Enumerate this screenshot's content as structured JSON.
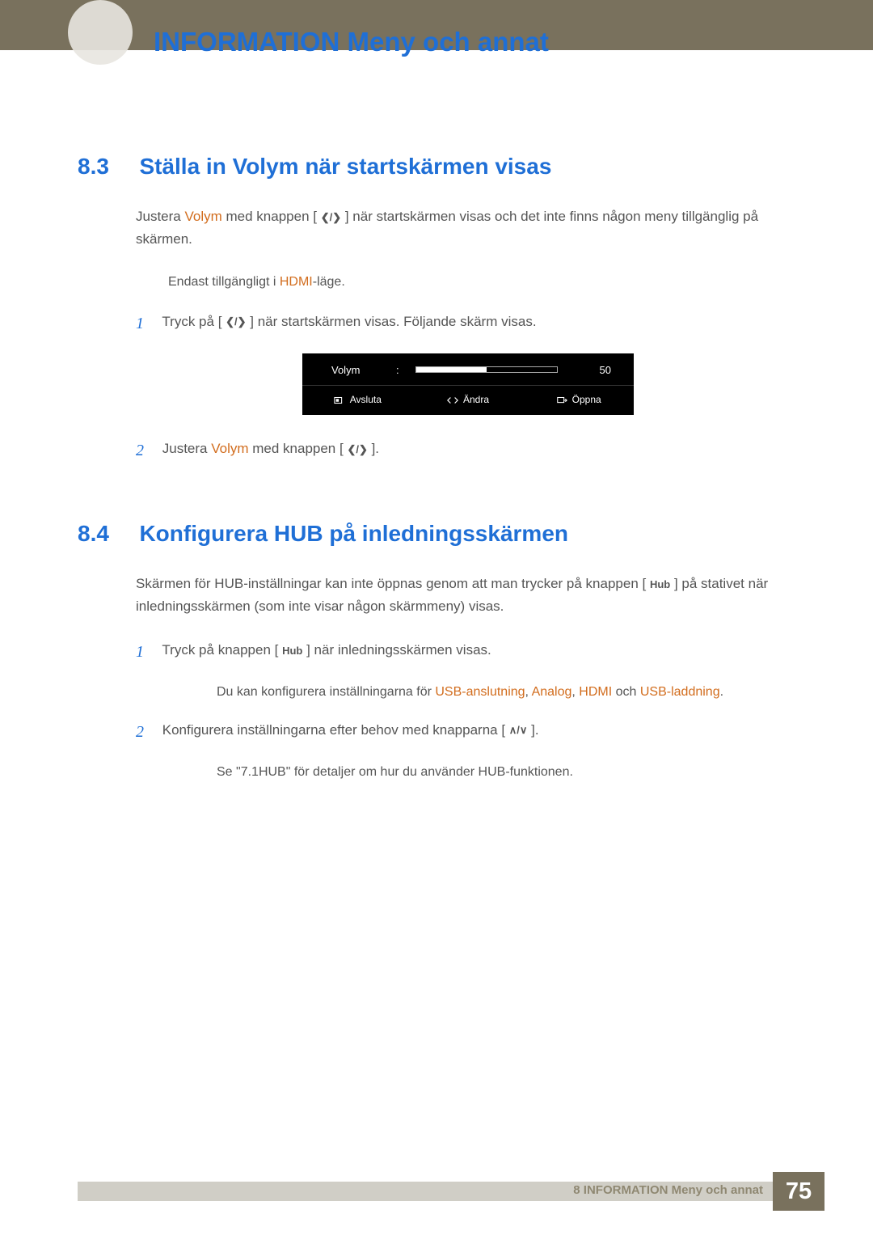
{
  "page_title": "INFORMATION Meny och annat",
  "section_83": {
    "num": "8.3",
    "title": "Ställa in Volym när startskärmen visas",
    "intro_pre": "Justera ",
    "intro_orange": "Volym",
    "intro_post": " med knappen [ ",
    "intro_tail": " ] när startskärmen visas och det inte finns någon meny tillgänglig på skärmen.",
    "note_pre": "Endast tillgängligt i ",
    "note_orange": "HDMI",
    "note_post": "-läge.",
    "step1_num": "1",
    "step1_pre": "Tryck på [ ",
    "step1_post": " ] när startskärmen visas. Följande skärm visas.",
    "step2_num": "2",
    "step2_pre": "Justera ",
    "step2_orange": "Volym",
    "step2_mid": " med knappen [ ",
    "step2_post": " ]."
  },
  "osd": {
    "label": "Volym",
    "value": "50",
    "btn_exit": "Avsluta",
    "btn_change": "Ändra",
    "btn_open": "Öppna"
  },
  "section_84": {
    "num": "8.4",
    "title": "Konfigurera HUB på inledningsskärmen",
    "intro_pre": "Skärmen för HUB-inställningar kan inte öppnas genom att man trycker på knappen [ ",
    "intro_post": " ] på stativet när inledningsskärmen (som inte  visar någon skärmmeny) visas.",
    "step1_num": "1",
    "step1_pre": "Tryck på knappen [ ",
    "step1_post": " ] när inledningsskärmen visas.",
    "subnote_pre": "Du kan konfigurera inställningarna för ",
    "subnote_o1": "USB-anslutning",
    "subnote_sep1": ", ",
    "subnote_o2": "Analog",
    "subnote_sep2": ", ",
    "subnote_o3": "HDMI",
    "subnote_sep3": " och ",
    "subnote_o4": "USB-laddning",
    "subnote_end": ".",
    "step2_num": "2",
    "step2_pre": "Konfigurera inställningarna efter behov med knapparna [ ",
    "step2_post": " ].",
    "ref": "Se \"7.1HUB\" för detaljer om hur du använder HUB-funktionen."
  },
  "footer": {
    "chapter": "8 INFORMATION Meny och annat",
    "page": "75"
  },
  "icons": {
    "leftright": "❮/❯",
    "hub": "Hub",
    "updown": "∧/∨"
  }
}
